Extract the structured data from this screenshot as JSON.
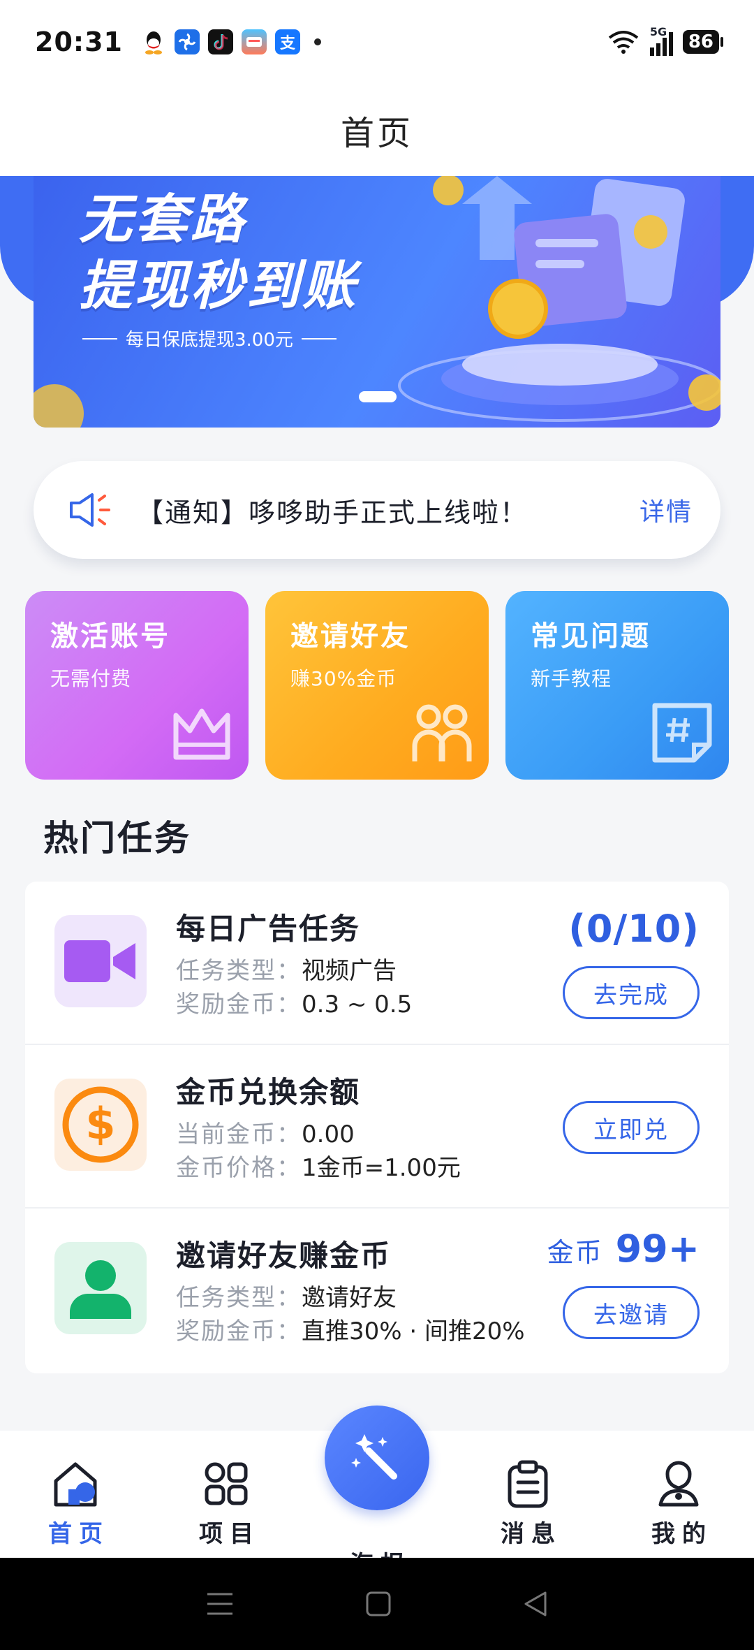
{
  "status_bar": {
    "time": "20:31",
    "network": "5G",
    "battery": "86",
    "notification_icons": [
      "qq-icon",
      "baidu-netdisk-icon",
      "tiktok-icon",
      "weather-app-icon",
      "alipay-icon"
    ]
  },
  "header": {
    "title": "首页"
  },
  "banner": {
    "line1": "无套路",
    "line2": "提现秒到账",
    "subtitle": "每日保底提现3.00元"
  },
  "notice": {
    "text": "【通知】哆哆助手正式上线啦！",
    "link": "详情"
  },
  "feature_cards": [
    {
      "title": "激活账号",
      "subtitle": "无需付费",
      "icon": "crown-icon"
    },
    {
      "title": "邀请好友",
      "subtitle": "赚30%金币",
      "icon": "friends-icon"
    },
    {
      "title": "常见问题",
      "subtitle": "新手教程",
      "icon": "hashtag-note-icon"
    }
  ],
  "section_title": "热门任务",
  "tasks": [
    {
      "title": "每日广告任务",
      "row1_key": "任务类型：",
      "row1_val": "视频广告",
      "row2_key": "奖励金币：",
      "row2_val": "0.3 ~ 0.5",
      "count": "(0/10)",
      "button": "去完成",
      "icon": "video-camera-icon"
    },
    {
      "title": "金币兑换余额",
      "row1_key": "当前金币：",
      "row1_val": "0.00",
      "row2_key": "金币价格：",
      "row2_val": "1金币=1.00元",
      "button": "立即兑",
      "icon": "dollar-coin-icon"
    },
    {
      "title": "邀请好友赚金币",
      "row1_key": "任务类型：",
      "row1_val": "邀请好友",
      "row2_key": "奖励金币：",
      "row2_val": "直推30% · 间推20%",
      "coin_label": "金币",
      "coin_value": "99+",
      "button": "去邀请",
      "icon": "user-icon"
    }
  ],
  "tabbar": [
    {
      "label": "首页",
      "icon": "home-icon",
      "active": true
    },
    {
      "label": "项目",
      "icon": "grid-icon"
    },
    {
      "label": "海报",
      "icon": "magic-wand-icon"
    },
    {
      "label": "消息",
      "icon": "clipboard-icon"
    },
    {
      "label": "我的",
      "icon": "profile-icon"
    }
  ],
  "colors": {
    "primary": "#3566e8",
    "card_purple": "#d36bf5",
    "card_orange": "#ffab1f",
    "card_blue": "#3a9cf6"
  }
}
